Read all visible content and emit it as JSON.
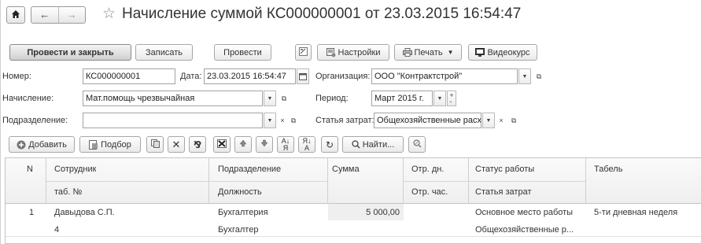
{
  "title": "Начисление суммой КС000000001 от 23.03.2015 16:54:47",
  "toolbar": {
    "post_close": "Провести и закрыть",
    "save": "Записать",
    "post": "Провести",
    "settings": "Настройки",
    "print": "Печать",
    "video": "Видеокурс"
  },
  "form": {
    "number_label": "Номер:",
    "number_value": "КС000000001",
    "date_label": "Дата:",
    "date_value": "23.03.2015 16:54:47",
    "org_label": "Организация:",
    "org_value": "ООО \"Контрактстрой\"",
    "accrual_label": "Начисление:",
    "accrual_value": "Мат.помощь чрезвычайная",
    "period_label": "Период:",
    "period_value": "Март 2015 г.",
    "dept_label": "Подразделение:",
    "dept_value": "",
    "cost_label": "Статья затрат:",
    "cost_value": "Общехозяйственные расходы"
  },
  "table_toolbar": {
    "add": "Добавить",
    "pick": "Подбор",
    "find": "Найти..."
  },
  "table": {
    "headers": {
      "n": "N",
      "employee": "Сотрудник",
      "tab_no": "таб. №",
      "department": "Подразделение",
      "position": "Должность",
      "sum": "Сумма",
      "days": "Отр. дн.",
      "hours": "Отр. час.",
      "work_status": "Статус работы",
      "cost_item": "Статья затрат",
      "timesheet": "Табель"
    },
    "rows": [
      {
        "n": "1",
        "employee": "Давыдова С.П.",
        "tab_no": "4",
        "department": "Бухгалтерия",
        "position": "Бухгалтер",
        "sum": "5 000,00",
        "days": "",
        "hours": "",
        "work_status": "Основное место работы",
        "cost_item": "Общехозяйственные р...",
        "timesheet": "5-ти дневная неделя"
      }
    ]
  }
}
